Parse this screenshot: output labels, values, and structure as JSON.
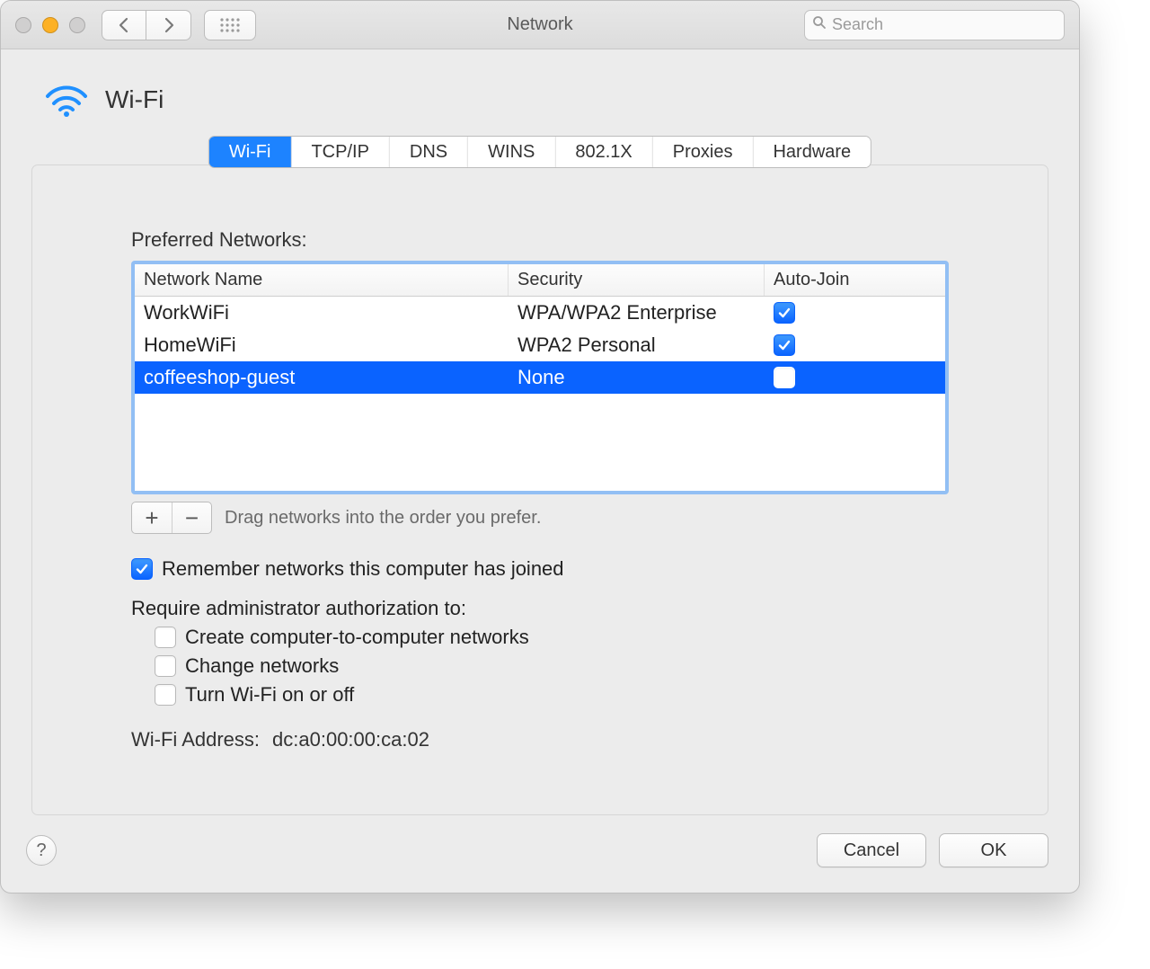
{
  "window": {
    "title": "Network"
  },
  "search": {
    "placeholder": "Search",
    "value": ""
  },
  "section": {
    "title": "Wi-Fi"
  },
  "tabs": [
    {
      "label": "Wi-Fi",
      "selected": true
    },
    {
      "label": "TCP/IP",
      "selected": false
    },
    {
      "label": "DNS",
      "selected": false
    },
    {
      "label": "WINS",
      "selected": false
    },
    {
      "label": "802.1X",
      "selected": false
    },
    {
      "label": "Proxies",
      "selected": false
    },
    {
      "label": "Hardware",
      "selected": false
    }
  ],
  "preferred_networks": {
    "label": "Preferred Networks:",
    "columns": {
      "name": "Network Name",
      "security": "Security",
      "autojoin": "Auto-Join"
    },
    "rows": [
      {
        "name": "WorkWiFi",
        "security": "WPA/WPA2 Enterprise",
        "autojoin": true,
        "selected": false
      },
      {
        "name": "HomeWiFi",
        "security": "WPA2 Personal",
        "autojoin": true,
        "selected": false
      },
      {
        "name": "coffeeshop-guest",
        "security": "None",
        "autojoin": false,
        "selected": true
      }
    ],
    "drag_hint": "Drag networks into the order you prefer."
  },
  "options": {
    "remember": {
      "label": "Remember networks this computer has joined",
      "checked": true
    },
    "require_label": "Require administrator authorization to:",
    "admin": [
      {
        "label": "Create computer-to-computer networks",
        "checked": false
      },
      {
        "label": "Change networks",
        "checked": false
      },
      {
        "label": "Turn Wi-Fi on or off",
        "checked": false
      }
    ]
  },
  "wifi_address": {
    "label": "Wi-Fi Address:",
    "value": "dc:a0:00:00:ca:02"
  },
  "buttons": {
    "cancel": "Cancel",
    "ok": "OK"
  }
}
